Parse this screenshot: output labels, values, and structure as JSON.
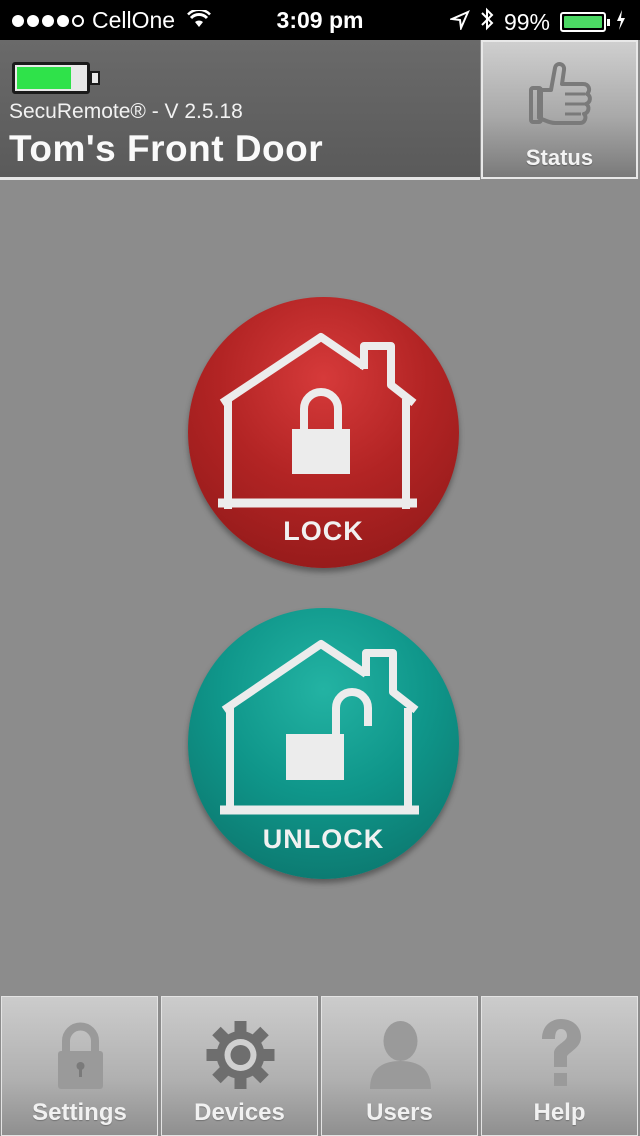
{
  "status_bar": {
    "carrier": "CellOne",
    "time": "3:09 pm",
    "battery_percent": "99%",
    "signal_bars": 4,
    "icons": [
      "wifi-icon",
      "location-icon",
      "bluetooth-icon",
      "charging-icon"
    ]
  },
  "header": {
    "app_version": "SecuRemote® - V 2.5.18",
    "door_name": "Tom's Front Door",
    "device_battery_level": 0.75,
    "status_button_label": "Status",
    "status_icon": "thumbs-up-icon"
  },
  "controls": {
    "lock_label": "LOCK",
    "unlock_label": "UNLOCK",
    "lock_color": "#b22424",
    "unlock_color": "#0f968a"
  },
  "tabs": [
    {
      "label": "Settings",
      "icon": "padlock-icon"
    },
    {
      "label": "Devices",
      "icon": "gear-icon"
    },
    {
      "label": "Users",
      "icon": "user-icon"
    },
    {
      "label": "Help",
      "icon": "question-icon"
    }
  ]
}
